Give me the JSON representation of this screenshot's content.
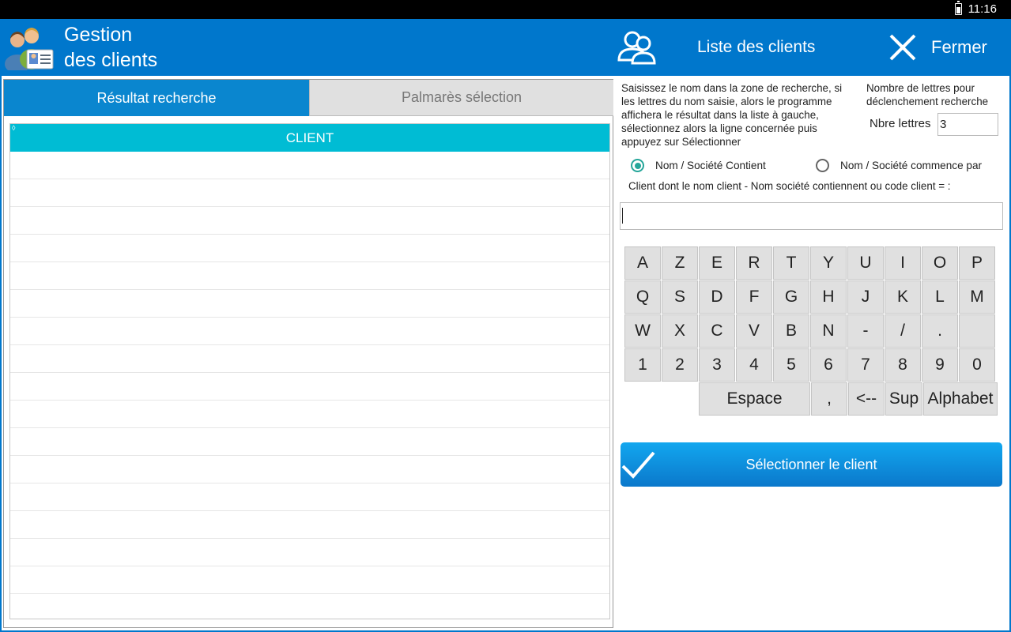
{
  "status_bar": {
    "time": "11:16"
  },
  "header": {
    "title_line1": "Gestion",
    "title_line2": "des clients",
    "list_label": "Liste des clients",
    "close_label": "Fermer"
  },
  "tabs": {
    "active": "Résultat recherche",
    "inactive": "Palmarès sélection"
  },
  "grid": {
    "column": "CLIENT",
    "rows": []
  },
  "right": {
    "instructions": "Saisissez le nom dans la zone de recherche, si les lettres du nom saisie, alors le programme affichera le résultat dans la liste à gauche, sélectionnez alors la ligne concernée puis appuyez sur Sélectionner",
    "nb_letters_label": "Nombre de lettres pour déclenchement recherche",
    "nbre_label": "Nbre lettres",
    "nbre_value": "3",
    "radio_contains": "Nom / Société Contient",
    "radio_starts": "Nom / Société commence par",
    "search_label": "Client dont le nom client - Nom société contiennent ou code client = :",
    "search_value": ""
  },
  "keyboard": {
    "rows": [
      [
        "A",
        "Z",
        "E",
        "R",
        "T",
        "Y",
        "U",
        "I",
        "O",
        "P"
      ],
      [
        "Q",
        "S",
        "D",
        "F",
        "G",
        "H",
        "J",
        "K",
        "L",
        "M"
      ],
      [
        "W",
        "X",
        "C",
        "V",
        "B",
        "N",
        "-",
        "/",
        ".",
        ""
      ],
      [
        "1",
        "2",
        "3",
        "4",
        "5",
        "6",
        "7",
        "8",
        "9",
        "0"
      ]
    ],
    "space": "Espace",
    "comma": ",",
    "backspace": "<--",
    "delete": "Sup",
    "alphabet": "Alphabet"
  },
  "select_button": "Sélectionner le client",
  "colors": {
    "header": "#0077cc",
    "tab_active": "#0a86cf",
    "grid_header": "#00bcd4",
    "radio": "#26a69a"
  }
}
